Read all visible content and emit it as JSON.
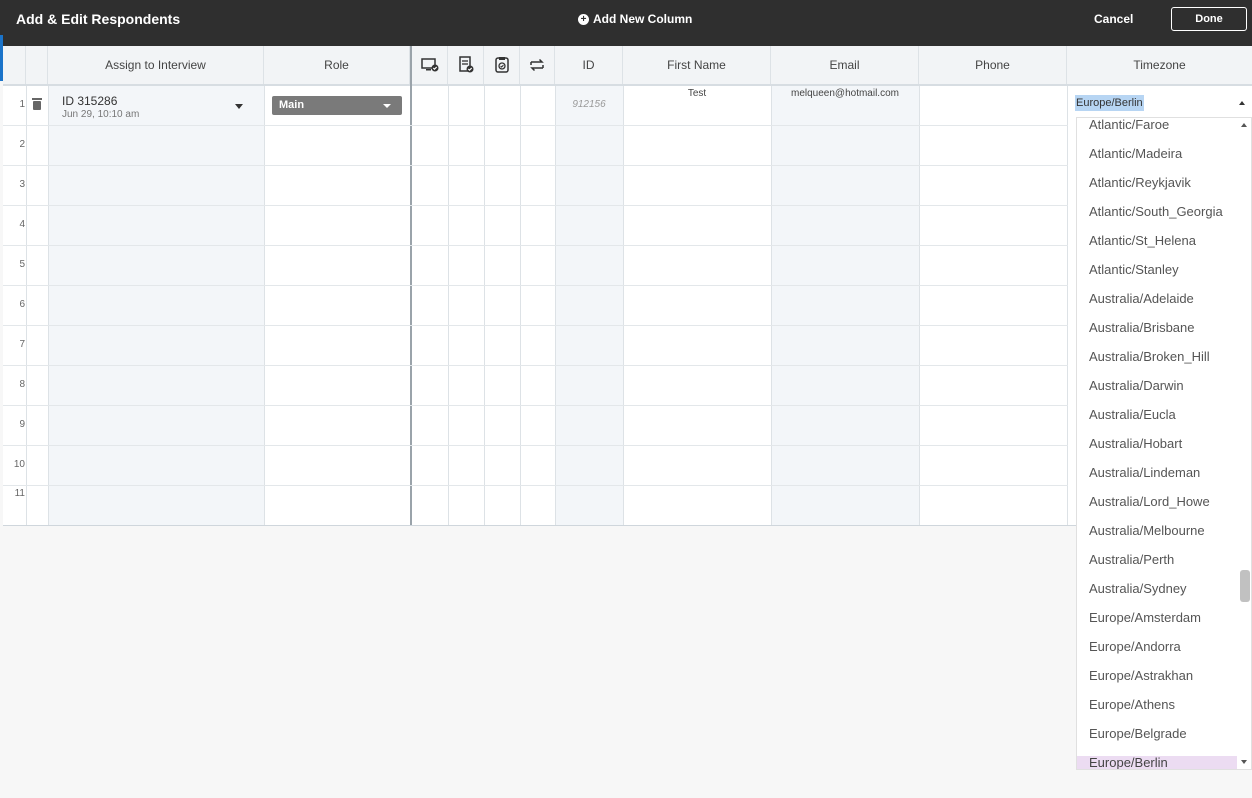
{
  "topbar": {
    "title": "Add & Edit Respondents",
    "add_column": "Add New Column",
    "cancel": "Cancel",
    "done": "Done"
  },
  "columns": {
    "assign": "Assign to Interview",
    "role": "Role",
    "icon1": "desktop-check-icon",
    "icon2": "list-check-icon",
    "icon3": "document-check-icon",
    "icon4": "swap-arrows-icon",
    "id": "ID",
    "first_name": "First Name",
    "email": "Email",
    "phone": "Phone",
    "timezone": "Timezone"
  },
  "rows": [
    "1",
    "2",
    "3",
    "4",
    "5",
    "6",
    "7",
    "8",
    "9",
    "10",
    "11"
  ],
  "row1": {
    "interview_id": "ID 315286",
    "interview_date": "Jun 29, 10:10 am",
    "role": "Main",
    "id": "912156",
    "first_name": "Test",
    "email": "melqueen@hotmail.com",
    "timezone": "Europe/Berlin"
  },
  "timezone_options": [
    "Atlantic/Faroe",
    "Atlantic/Madeira",
    "Atlantic/Reykjavik",
    "Atlantic/South_Georgia",
    "Atlantic/St_Helena",
    "Atlantic/Stanley",
    "Australia/Adelaide",
    "Australia/Brisbane",
    "Australia/Broken_Hill",
    "Australia/Darwin",
    "Australia/Eucla",
    "Australia/Hobart",
    "Australia/Lindeman",
    "Australia/Lord_Howe",
    "Australia/Melbourne",
    "Australia/Perth",
    "Australia/Sydney",
    "Europe/Amsterdam",
    "Europe/Andorra",
    "Europe/Astrakhan",
    "Europe/Athens",
    "Europe/Belgrade",
    "Europe/Berlin"
  ],
  "selected_timezone_index": 22
}
